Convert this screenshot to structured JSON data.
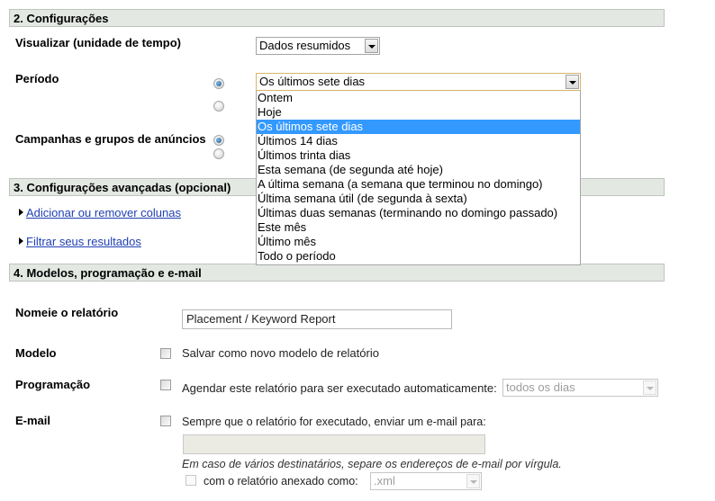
{
  "section2": {
    "title": "2. Configurações",
    "view_label": "Visualizar (unidade de tempo)",
    "view_select_value": "Dados resumidos",
    "period_label": "Período",
    "period_select_value": "Os últimos sete dias",
    "period_options": [
      "Ontem",
      "Hoje",
      "Os últimos sete dias",
      "Últimos 14 dias",
      "Últimos trinta dias",
      "Esta semana (de segunda até hoje)",
      "A última semana (a semana que terminou no domingo)",
      "Última semana útil (de segunda à sexta)",
      "Últimas duas semanas (terminando no domingo passado)",
      "Este mês",
      "Último mês",
      "Todo o período"
    ],
    "period_selected_index": 2,
    "campaigns_label": "Campanhas e grupos de anúncios"
  },
  "section3": {
    "title": "3. Configurações avançadas (opcional)",
    "link_columns": "Adicionar ou remover colunas",
    "link_filter": "Filtrar seus resultados"
  },
  "section4": {
    "title": "4. Modelos, programação e e-mail",
    "name_label": "Nomeie o relatório",
    "name_value": "Placement / Keyword Report",
    "template_label": "Modelo",
    "template_checkbox_text": "Salvar como novo modelo de relatório",
    "schedule_label": "Programação",
    "schedule_checkbox_text": "Agendar este relatório para ser executado automaticamente:",
    "schedule_select_value": "todos os dias",
    "email_label": "E-mail",
    "email_checkbox_text": "Sempre que o relatório for executado, enviar um e-mail para:",
    "email_value": "",
    "email_hint": "Em caso de vários destinatários, separe os endereços de e-mail por vírgula.",
    "attach_checkbox_text": "com o relatório anexado como:",
    "attach_select_value": ".xml"
  }
}
